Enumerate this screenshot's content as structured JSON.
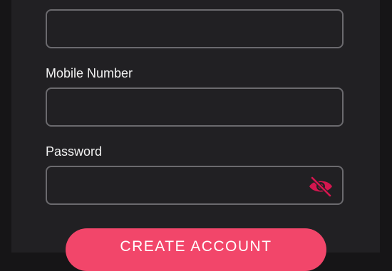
{
  "form": {
    "fields": [
      {
        "id": "name",
        "label": "",
        "value": ""
      },
      {
        "id": "mobile",
        "label": "Mobile Number",
        "value": ""
      },
      {
        "id": "password",
        "label": "Password",
        "value": ""
      }
    ],
    "password_toggle_icon": "eye-off-icon",
    "submit_label": "CREATE ACCOUNT"
  },
  "colors": {
    "background": "#161517",
    "panel": "#212023",
    "field_border": "#6b6a6e",
    "accent": "#f2466a",
    "icon": "#d4164f"
  }
}
